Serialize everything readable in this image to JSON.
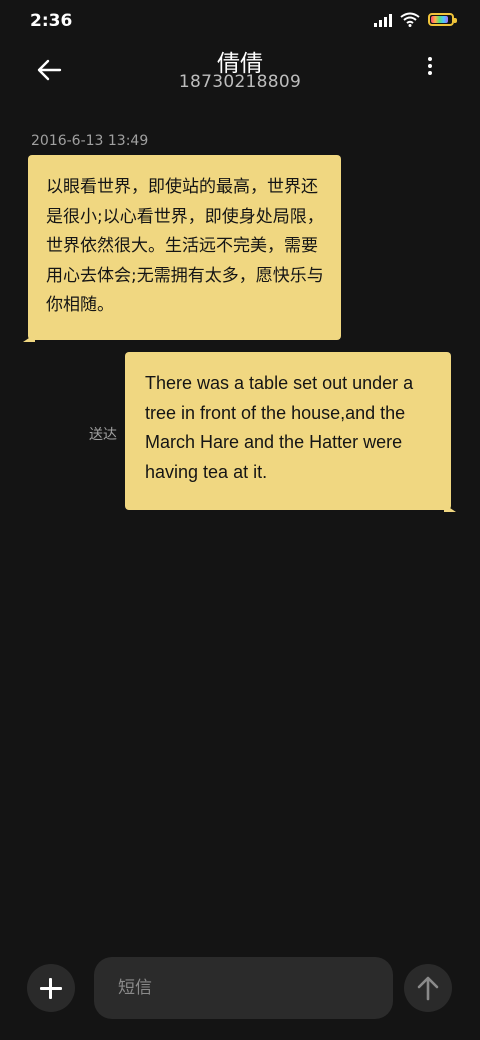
{
  "status_bar": {
    "time": "2:36",
    "icons": [
      "signal-icon",
      "wifi-icon",
      "battery-icon"
    ],
    "battery_level": 0.85,
    "battery_color": "#f0c43a"
  },
  "header": {
    "back_icon": "arrow-left-icon",
    "contact_name": "倩倩",
    "phone_number": "18730218809",
    "more_icon": "more-vertical-icon"
  },
  "conversation": {
    "timestamp": "2016-6-13 13:49",
    "messages": [
      {
        "direction": "incoming",
        "text": "以眼看世界，即使站的最高，世界还是很小;以心看世界，即使身处局限，世界依然很大。生活远不完美，需要用心去体会;无需拥有太多，愿快乐与你相随。"
      },
      {
        "direction": "outgoing",
        "text": "There was a table set out under a tree in front of the house,and the March Hare and the Hatter were having tea at it.",
        "status": "送达"
      }
    ],
    "bubble_color": "#f0d781"
  },
  "composer": {
    "add_icon": "plus-icon",
    "placeholder": "短信",
    "value": "",
    "send_icon": "arrow-up-icon"
  },
  "colors": {
    "background": "#141414",
    "bubble": "#f0d781",
    "secondary_text": "#a0a0a0"
  }
}
